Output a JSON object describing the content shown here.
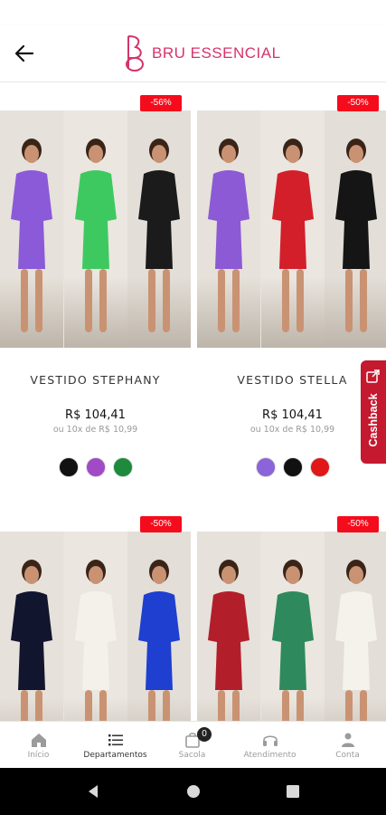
{
  "header": {
    "brand": "BRU ESSENCIAL",
    "brand_mark": "BE"
  },
  "products": [
    {
      "name": "VESTIDO STEPHANY",
      "price": "R$ 104,41",
      "installments": "ou 10x de R$ 10,99",
      "discount": "-56%",
      "photo_dresses": [
        "#8a5ad8",
        "#3ec960",
        "#1b1b1b"
      ],
      "swatches": [
        "#111111",
        "#a14ac6",
        "#1d8a3d"
      ]
    },
    {
      "name": "VESTIDO STELLA",
      "price": "R$ 104,41",
      "installments": "ou 10x de R$ 10,99",
      "discount": "-50%",
      "photo_dresses": [
        "#8c5ad4",
        "#d31f2a",
        "#151515"
      ],
      "swatches": [
        "#8a64d8",
        "#111111",
        "#e01818"
      ]
    },
    {
      "name": "",
      "price": "",
      "installments": "",
      "discount": "-50%",
      "photo_dresses": [
        "#12152e",
        "#f4f1ea",
        "#1e3fd0"
      ],
      "swatches": []
    },
    {
      "name": "",
      "price": "",
      "installments": "",
      "discount": "-50%",
      "photo_dresses": [
        "#b21f2b",
        "#2e8a5c",
        "#f5f2ec"
      ],
      "swatches": []
    }
  ],
  "cashback": {
    "label": "Cashback"
  },
  "bottom_nav": [
    {
      "label": "Início",
      "icon": "home-icon",
      "active": false
    },
    {
      "label": "Departamentos",
      "icon": "list-icon",
      "active": true
    },
    {
      "label": "Sacola",
      "icon": "bag-icon",
      "active": false,
      "badge": "0"
    },
    {
      "label": "Atendimento",
      "icon": "headset-icon",
      "active": false
    },
    {
      "label": "Conta",
      "icon": "person-icon",
      "active": false
    }
  ],
  "colors": {
    "brand": "#d6336c",
    "discount_badge": "#f50c1c",
    "cashback": "#c4192f"
  }
}
